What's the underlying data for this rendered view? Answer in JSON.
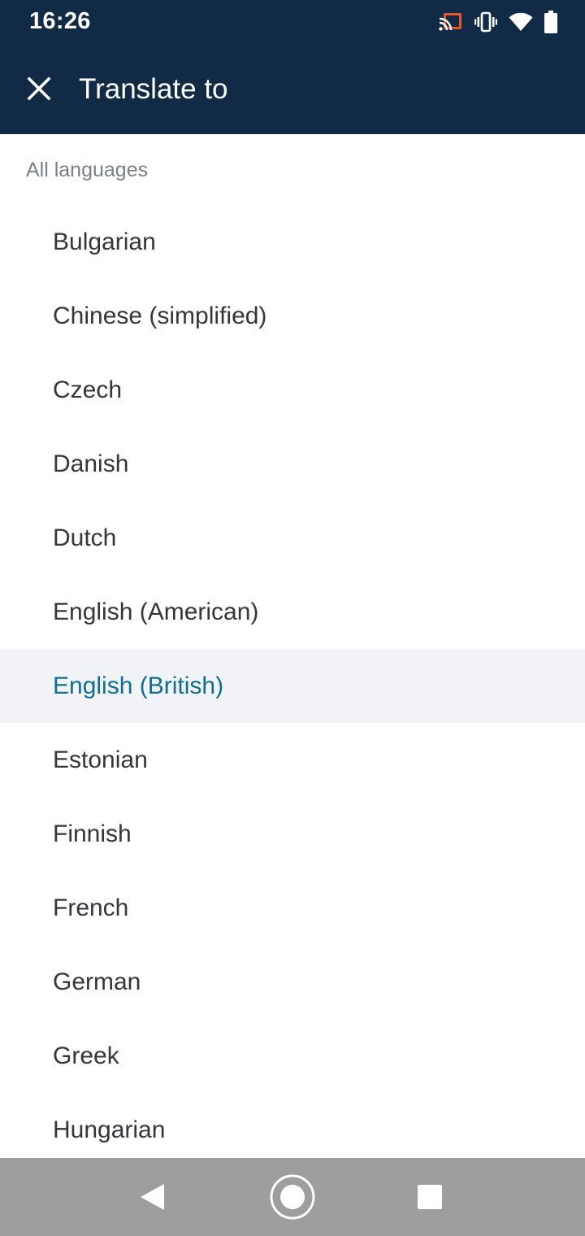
{
  "status_bar": {
    "time": "16:26",
    "icons": [
      "cast-icon",
      "vibrate-icon",
      "wifi-icon",
      "battery-icon"
    ]
  },
  "toolbar": {
    "close_icon": "close-icon",
    "title": "Translate to"
  },
  "section": {
    "label": "All languages"
  },
  "languages": [
    "Bulgarian",
    "Chinese (simplified)",
    "Czech",
    "Danish",
    "Dutch",
    "English (American)",
    "English (British)",
    "Estonian",
    "Finnish",
    "French",
    "German",
    "Greek",
    "Hungarian"
  ],
  "selected_language": "English (British)",
  "colors": {
    "header_bg": "#112b47",
    "selected_bg": "#f1f3f6",
    "selected_text": "#0f6f93",
    "cast_accent": "#e8542f"
  },
  "nav_bar": {
    "buttons": [
      "back-icon",
      "home-icon",
      "recents-icon"
    ]
  }
}
